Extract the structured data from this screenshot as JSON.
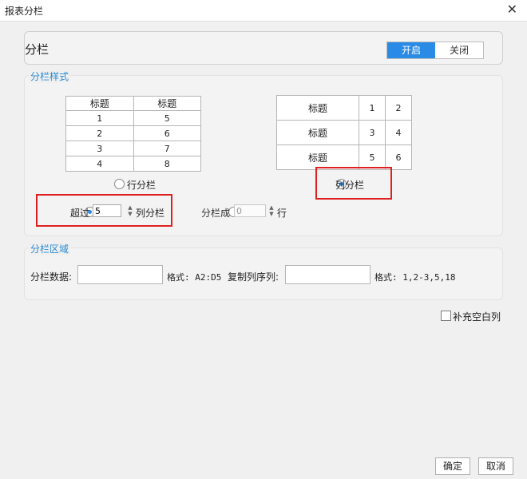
{
  "window": {
    "title": "报表分栏",
    "close_glyph": "✕"
  },
  "split": {
    "label": "分栏",
    "toggle_on": "开启",
    "toggle_off": "关闭"
  },
  "style_section": {
    "title": "分栏样式"
  },
  "row_preview": {
    "headers": [
      "标题",
      "标题"
    ],
    "rows": [
      [
        "1",
        "5"
      ],
      [
        "2",
        "6"
      ],
      [
        "3",
        "7"
      ],
      [
        "4",
        "8"
      ]
    ]
  },
  "col_preview": {
    "rows": [
      [
        "标题",
        "1",
        "2"
      ],
      [
        "标题",
        "3",
        "4"
      ],
      [
        "标题",
        "5",
        "6"
      ]
    ]
  },
  "options": {
    "row_split": "行分栏",
    "col_split": "列分栏",
    "exceed_label": "超过",
    "exceed_value": "5",
    "exceed_suffix": "列分栏",
    "split_into_label": "分栏成",
    "split_into_value": "0",
    "split_into_suffix": "行"
  },
  "area_section": {
    "title": "分栏区域",
    "data_label": "分栏数据:",
    "data_format": "格式: A2:D5",
    "copy_label": "复制列序列:",
    "copy_format": "格式: 1,2-3,5,18"
  },
  "fill_blank_columns": "补充空白列",
  "footer": {
    "ok": "确定",
    "cancel": "取消"
  },
  "colors": {
    "accent": "#2a8be6",
    "highlight": "#e02020"
  }
}
